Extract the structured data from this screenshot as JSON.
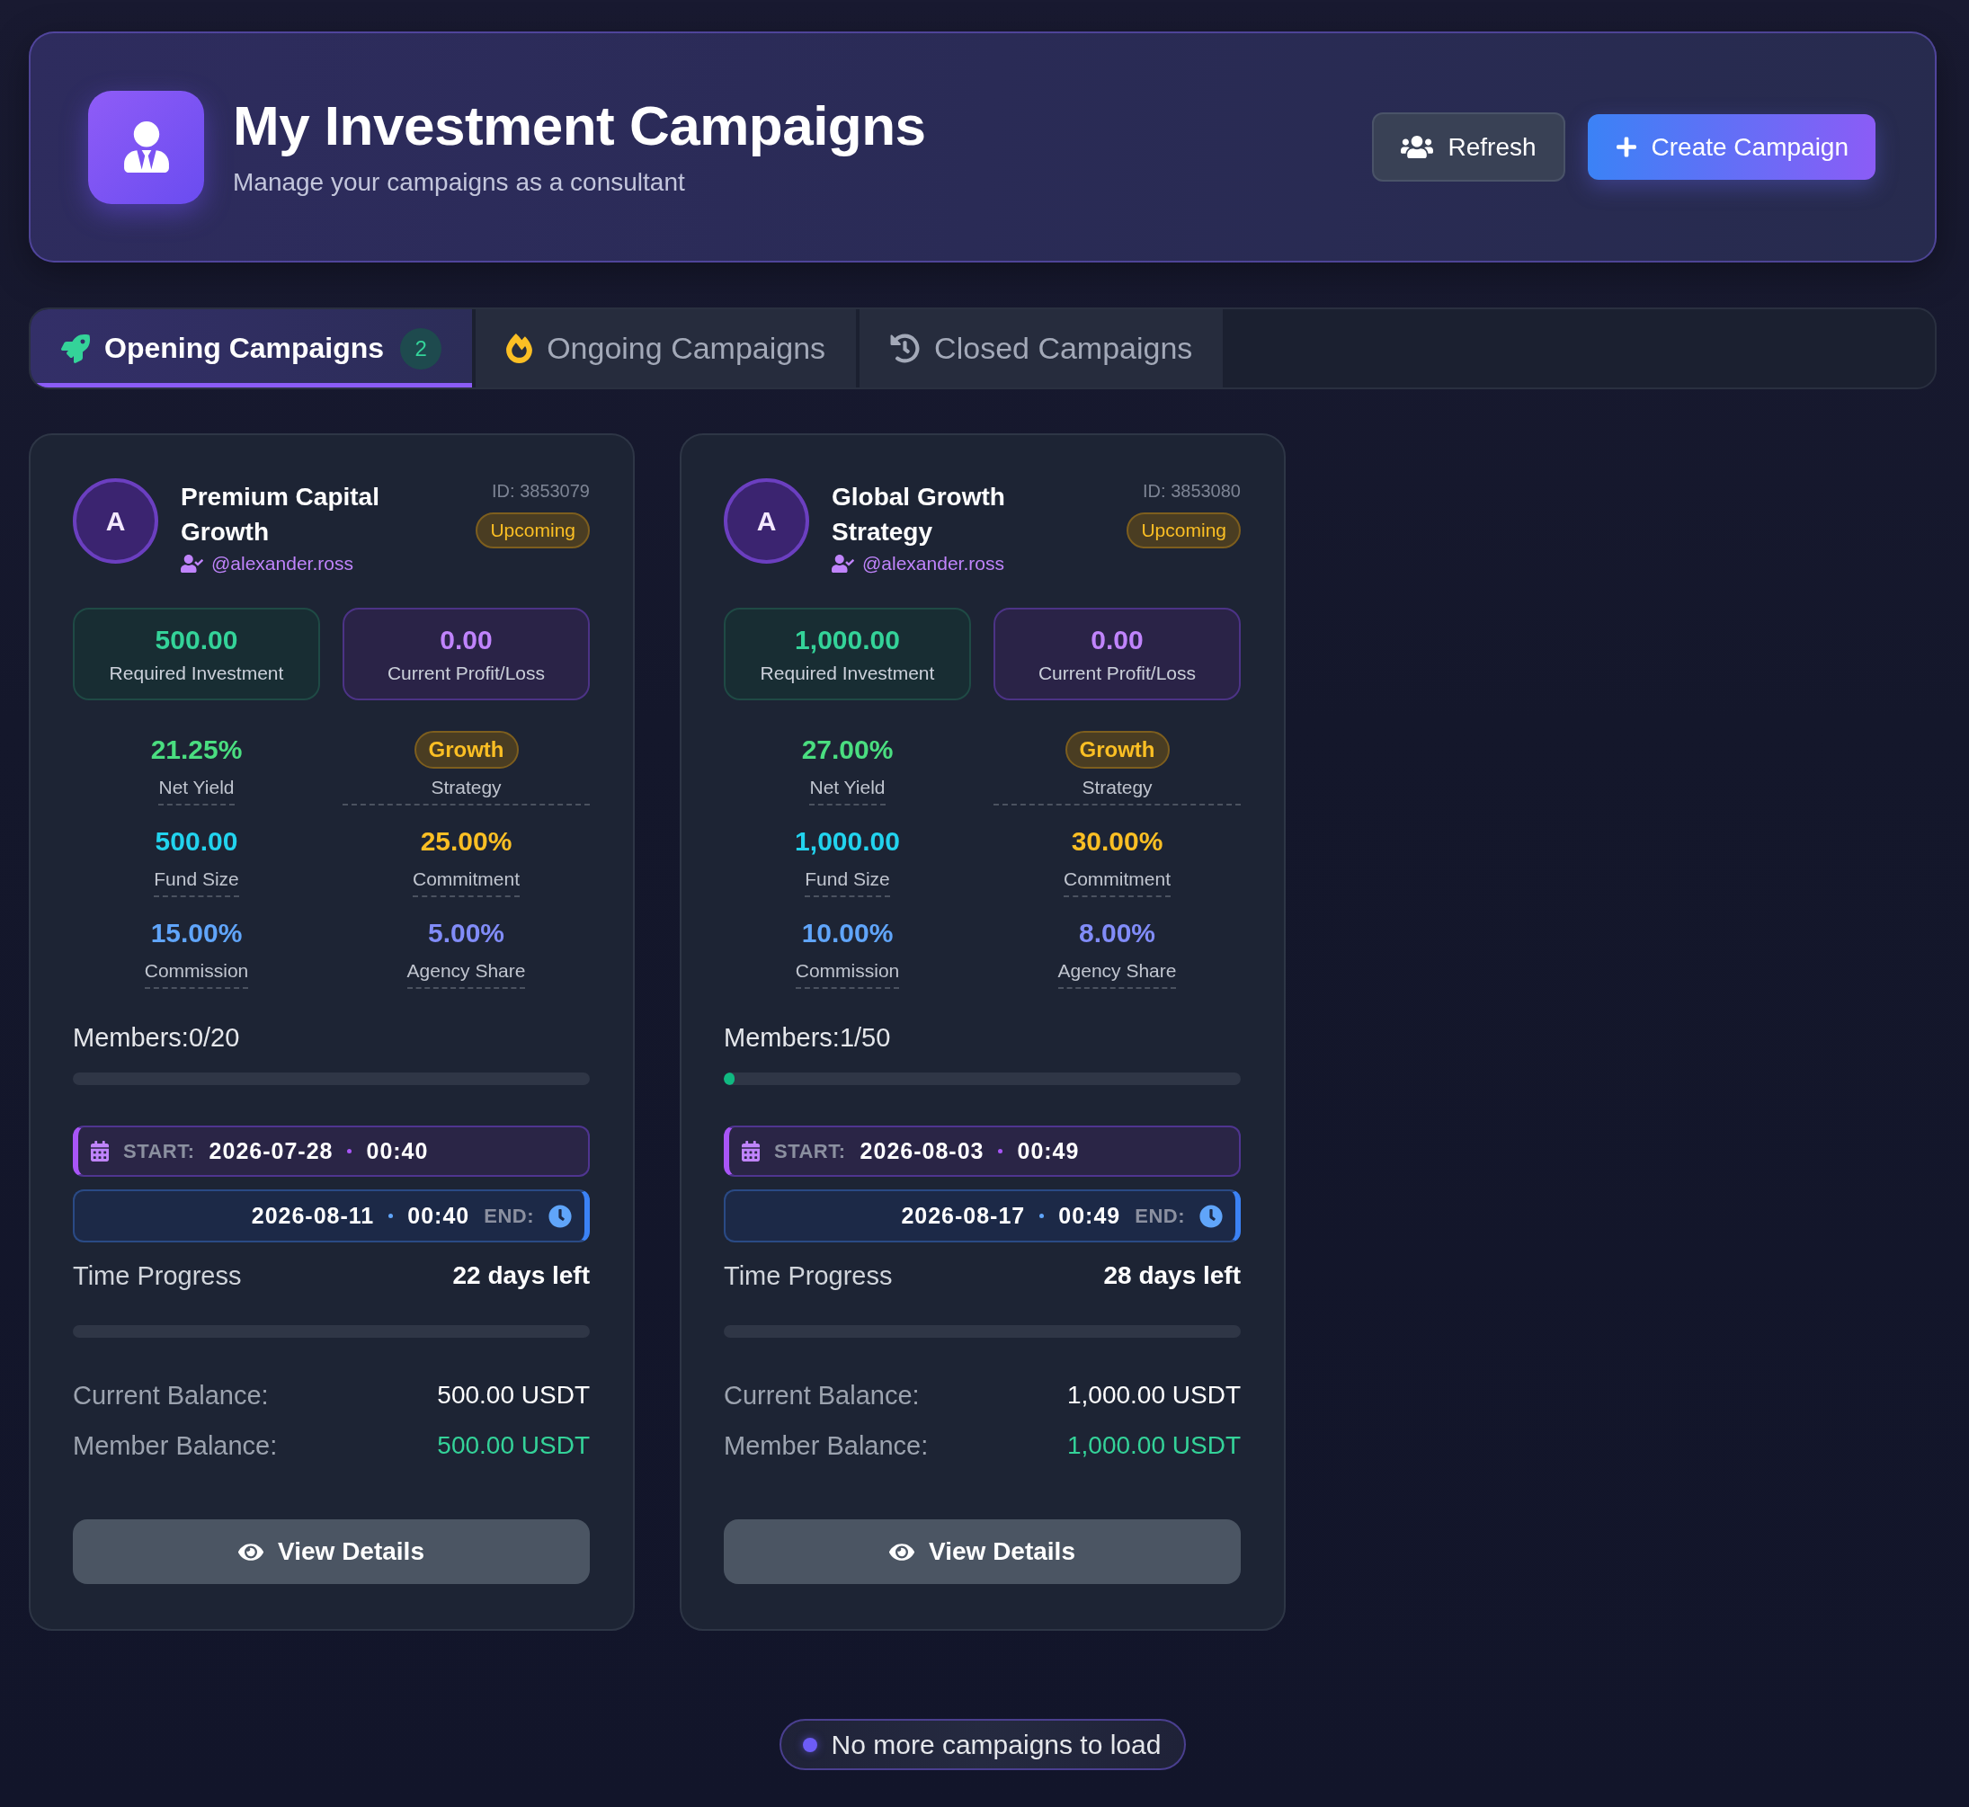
{
  "header": {
    "title": "My Investment Campaigns",
    "subtitle": "Manage your campaigns as a consultant",
    "buttons": [
      {
        "label": "Refresh",
        "kind": "secondary"
      },
      {
        "label": "Create Campaign",
        "kind": "primary"
      }
    ]
  },
  "tabs": [
    {
      "label": "Opening Campaigns",
      "count": "2",
      "selected": true
    },
    {
      "label": "Ongoing Campaigns",
      "selected": false
    },
    {
      "label": "Closed Campaigns",
      "selected": false
    }
  ],
  "campaigns": [
    {
      "avatar": "A",
      "name": "Premium Capital Growth",
      "handle": "@alexander.ross",
      "id": "ID: 3853079",
      "status": "Upcoming",
      "stats": [
        {
          "kind": "investment",
          "value": "500.00",
          "label": "Required Investment"
        },
        {
          "kind": "profit",
          "value": "0.00",
          "label": "Current Profit/Loss"
        }
      ],
      "metrics": [
        {
          "kind": "value",
          "value": "21.25%",
          "label": "Net Yield",
          "color": "#4ade80"
        },
        {
          "kind": "badge",
          "value": "Growth",
          "label": "Strategy"
        },
        {
          "kind": "value",
          "value": "500.00",
          "label": "Fund Size",
          "color": "#22d3ee"
        },
        {
          "kind": "value",
          "value": "25.00%",
          "label": "Commitment",
          "color": "#fbbf24"
        },
        {
          "kind": "value",
          "value": "15.00%",
          "label": "Commission",
          "color": "#60a5fa"
        },
        {
          "kind": "value",
          "value": "5.00%",
          "label": "Agency Share",
          "color": "#818cf8"
        }
      ],
      "members": {
        "text": "Members:0/20"
      },
      "start": {
        "label": "START:",
        "date": "2026-07-28",
        "time": "00:40"
      },
      "end": {
        "label": "END:",
        "date": "2026-08-11",
        "time": "00:40"
      },
      "time_progress": {
        "label": "Time Progress",
        "remaining": "22 days left"
      },
      "balances": [
        {
          "kind": "plain",
          "label": "Current Balance:",
          "value": "500.00 USDT"
        },
        {
          "kind": "highlight",
          "label": "Member Balance:",
          "value": "500.00 USDT"
        }
      ],
      "action": "View Details"
    },
    {
      "avatar": "A",
      "name": "Global Growth Strategy",
      "handle": "@alexander.ross",
      "id": "ID: 3853080",
      "status": "Upcoming",
      "stats": [
        {
          "kind": "investment",
          "value": "1,000.00",
          "label": "Required Investment"
        },
        {
          "kind": "profit",
          "value": "0.00",
          "label": "Current Profit/Loss"
        }
      ],
      "metrics": [
        {
          "kind": "value",
          "value": "27.00%",
          "label": "Net Yield",
          "color": "#4ade80"
        },
        {
          "kind": "badge",
          "value": "Growth",
          "label": "Strategy"
        },
        {
          "kind": "value",
          "value": "1,000.00",
          "label": "Fund Size",
          "color": "#22d3ee"
        },
        {
          "kind": "value",
          "value": "30.00%",
          "label": "Commitment",
          "color": "#fbbf24"
        },
        {
          "kind": "value",
          "value": "10.00%",
          "label": "Commission",
          "color": "#60a5fa"
        },
        {
          "kind": "value",
          "value": "8.00%",
          "label": "Agency Share",
          "color": "#818cf8"
        }
      ],
      "members": {
        "text": "Members:1/50",
        "level": 0.02
      },
      "start": {
        "label": "START:",
        "date": "2026-08-03",
        "time": "00:49"
      },
      "end": {
        "label": "END:",
        "date": "2026-08-17",
        "time": "00:49"
      },
      "time_progress": {
        "label": "Time Progress",
        "remaining": "28 days left"
      },
      "balances": [
        {
          "kind": "plain",
          "label": "Current Balance:",
          "value": "1,000.00 USDT"
        },
        {
          "kind": "highlight",
          "label": "Member Balance:",
          "value": "1,000.00 USDT"
        }
      ],
      "action": "View Details"
    }
  ],
  "footer": {
    "text": "No more campaigns to load"
  }
}
